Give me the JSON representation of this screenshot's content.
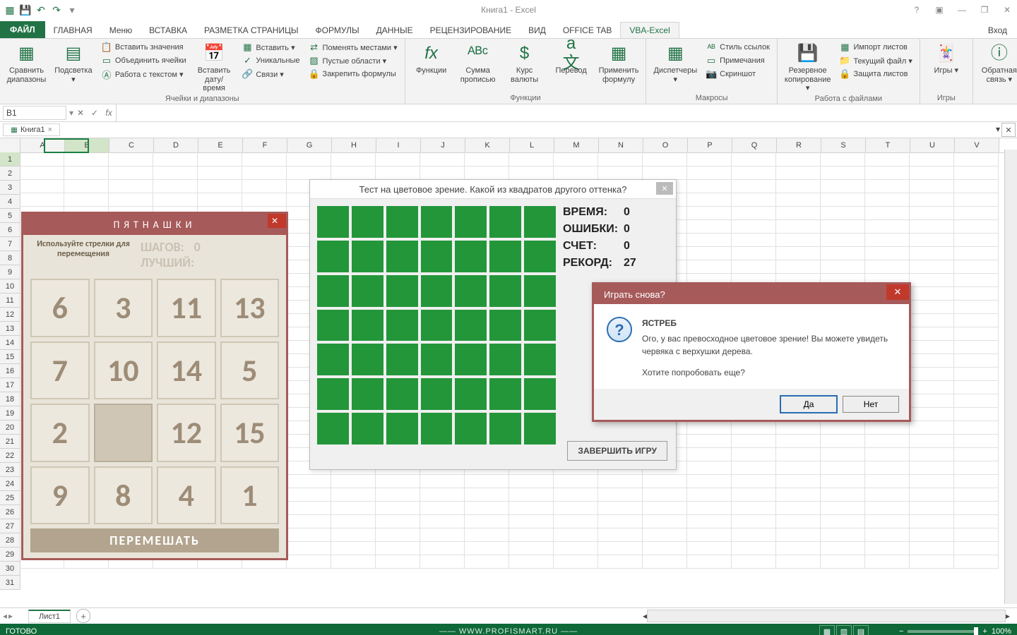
{
  "app": {
    "title": "Книга1 - Excel",
    "login": "Вход"
  },
  "qat": {
    "save": "save",
    "undo": "undo",
    "redo": "redo"
  },
  "win": {
    "help": "?",
    "ribbonopts": "▣",
    "min": "—",
    "max": "❐",
    "close": "✕"
  },
  "tabs": {
    "file": "ФАЙЛ",
    "home": "ГЛАВНАЯ",
    "menu": "Меню",
    "insert": "ВСТАВКА",
    "pagelayout": "РАЗМЕТКА СТРАНИЦЫ",
    "formulas": "ФОРМУЛЫ",
    "data": "ДАННЫЕ",
    "review": "РЕЦЕНЗИРОВАНИЕ",
    "view": "ВИД",
    "office": "OFFICE TAB",
    "vba": "VBA-Excel"
  },
  "ribbon": {
    "g1": {
      "label": "Ячейки и диапазоны",
      "compare": "Сравнить диапазоны",
      "highlight": "Подсветка ▾",
      "insval": "Вставить значения",
      "merge": "Объединить ячейки",
      "worktext": "Работа с текстом ▾",
      "insert": "Вставить ▾",
      "insertdt": "Вставить дату/время",
      "unique": "Уникальные",
      "links": "Связи ▾",
      "swap": "Поменять местами ▾",
      "empty": "Пустые области ▾",
      "lock": "Закрепить формулы"
    },
    "g2": {
      "label": "Функции",
      "fx": "Функции",
      "sum": "Сумма прописью",
      "curr": "Курс валюты",
      "trans": "Перевод",
      "apply": "Применить формулу"
    },
    "g3": {
      "label": "Макросы",
      "disp": "Диспетчеры ▾",
      "style": "Стиль ссылок",
      "note": "Примечания",
      "shot": "Скриншот"
    },
    "g4": {
      "label": "Работа с файлами",
      "backup": "Резервное копирование ▾",
      "import": "Импорт листов",
      "curfile": "Текущий файл ▾",
      "protect": "Защита листов"
    },
    "g5": {
      "label": "Игры",
      "games": "Игры ▾"
    },
    "g6": {
      "label": "",
      "feedback": "Обратная связь ▾"
    }
  },
  "namebox": "B1",
  "doctab": {
    "name": "Книга1"
  },
  "cols": [
    "A",
    "B",
    "C",
    "D",
    "E",
    "F",
    "G",
    "H",
    "I",
    "J",
    "K",
    "L",
    "M",
    "N",
    "O",
    "P",
    "Q",
    "R",
    "S",
    "T",
    "U",
    "V"
  ],
  "rows": [
    "1",
    "2",
    "3",
    "4",
    "5",
    "6",
    "7",
    "8",
    "9",
    "10",
    "11",
    "12",
    "13",
    "14",
    "15",
    "16",
    "17",
    "18",
    "19",
    "20",
    "21",
    "22",
    "23",
    "24",
    "25",
    "26",
    "27",
    "28",
    "29",
    "30",
    "31"
  ],
  "sheet": {
    "name": "Лист1"
  },
  "status": {
    "ready": "ГОТОВО",
    "zoom": "100%",
    "watermark": "—— WWW.PROFISMART.RU ——"
  },
  "puzzle": {
    "title": "ПЯТНАШКИ",
    "hint": "Используйте стрелки для перемещения",
    "steps_lbl": "ШАГОВ:",
    "steps": "0",
    "best_lbl": "ЛУЧШИЙ:",
    "best": "",
    "tiles": [
      "6",
      "3",
      "11",
      "13",
      "7",
      "10",
      "14",
      "5",
      "2",
      "",
      "12",
      "15",
      "9",
      "8",
      "4",
      "1"
    ],
    "shuffle": "ПЕРЕМЕШАТЬ"
  },
  "colortest": {
    "title": "Тест на цветовое зрение. Какой из квадратов другого оттенка?",
    "time_lbl": "ВРЕМЯ:",
    "time": "0",
    "err_lbl": "ОШИБКИ:",
    "err": "0",
    "score_lbl": "СЧЕТ:",
    "score": "0",
    "record_lbl": "РЕКОРД:",
    "record": "27",
    "end": "ЗАВЕРШИТЬ ИГРУ"
  },
  "msgbox": {
    "title": "Играть снова?",
    "heading": "ЯСТРЕБ",
    "line1": "Ого, у вас превосходное цветовое зрение! Вы можете увидеть червяка с верхушки дерева.",
    "line2": "Хотите попробовать еще?",
    "yes": "Да",
    "no": "Нет"
  }
}
